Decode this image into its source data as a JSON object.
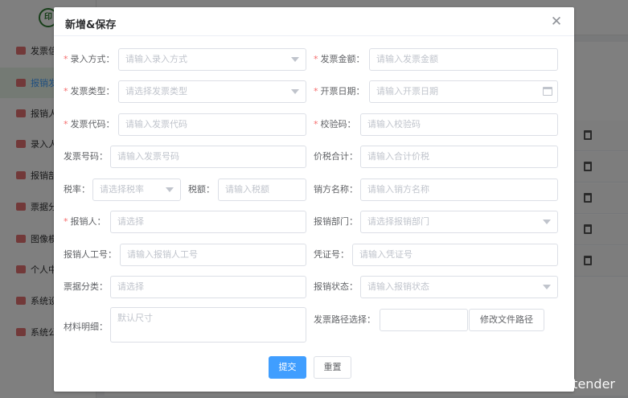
{
  "background": {
    "logo_text": "印",
    "menu": [
      {
        "label": "发票信"
      },
      {
        "label": "报销发"
      },
      {
        "label": "报销人"
      },
      {
        "label": "录入人"
      },
      {
        "label": "报销部"
      },
      {
        "label": "票据分"
      },
      {
        "label": "图像模"
      },
      {
        "label": "个人中"
      },
      {
        "label": "系统设"
      },
      {
        "label": "系统公"
      }
    ]
  },
  "dialog": {
    "title": "新增&保存",
    "close_glyph": "✕",
    "fields": {
      "entry_method": {
        "label": "录入方式：",
        "placeholder": "请输入录入方式"
      },
      "invoice_amount": {
        "label": "发票金额：",
        "placeholder": "请输入发票金额"
      },
      "invoice_type": {
        "label": "发票类型：",
        "placeholder": "请选择发票类型"
      },
      "issue_date": {
        "label": "开票日期：",
        "placeholder": "请输入开票日期"
      },
      "invoice_code": {
        "label": "发票代码：",
        "placeholder": "请输入发票代码"
      },
      "check_code": {
        "label": "校验码：",
        "placeholder": "请输入校验码"
      },
      "invoice_number": {
        "label": "发票号码：",
        "placeholder": "请输入发票号码"
      },
      "total_price_tax": {
        "label": "价税合计：",
        "placeholder": "请输入合计价税"
      },
      "tax_rate": {
        "label": "税率：",
        "placeholder": "请选择税率"
      },
      "tax_amount": {
        "label": "税额：",
        "placeholder": "请输入税额"
      },
      "seller_name": {
        "label": "销方名称：",
        "placeholder": "请输入销方名称"
      },
      "reimburser": {
        "label": "报销人：",
        "placeholder": "请选择"
      },
      "reimburse_dept": {
        "label": "报销部门：",
        "placeholder": "请选择报销部门"
      },
      "reimburser_id": {
        "label": "报销人工号：",
        "placeholder": "请输入报销人工号"
      },
      "voucher_no": {
        "label": "凭证号：",
        "placeholder": "请输入凭证号"
      },
      "bill_category": {
        "label": "票据分类：",
        "placeholder": "请选择"
      },
      "reimburse_status": {
        "label": "报销状态：",
        "placeholder": "请输入报销状态"
      },
      "material_detail": {
        "label": "材料明细：",
        "placeholder": "默认尺寸"
      },
      "invoice_path": {
        "label": "发票路径选择：",
        "value": ""
      }
    },
    "change_path_button": "修改文件路径",
    "submit_button": "提交",
    "reset_button": "重置"
  },
  "watermark": "CSDN @The  pretender",
  "colors": {
    "primary": "#409eff",
    "required": "#f56c6c",
    "overlay": "rgba(0,0,0,0.5)"
  }
}
